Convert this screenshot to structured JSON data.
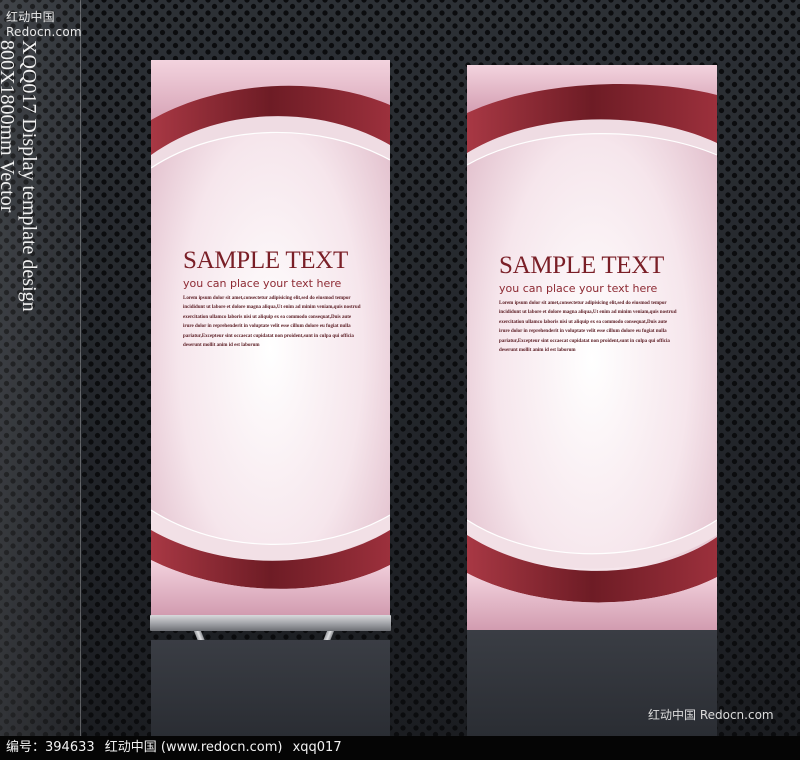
{
  "watermark_top": "红动中国 Redocn.com",
  "side_caption": {
    "line1": "XQQ017 Display template design",
    "line2": "800X1800mm Vector"
  },
  "banners": [
    {
      "title": "SAMPLE TEXT",
      "subtitle": "you can place your text here",
      "body": "Lorem ipsum dolor sit amet,consectetur adipisicing elit,sed do eiusmod tempor incididunt ut labore et dolore magna aliqua,Ut enim ad minim veniam,quis nostrud exercitation ullamco laboris nisi ut aliquip ex ea commodo consequat,Duis aute irure dolor in reprehenderit in voluptate velit esse cillum dolore eu fugiat nulla pariatur,Excepteur sint occaecat cupidatat non proident,sunt in culpa qui officia deserunt mollit anim id est laborum"
    },
    {
      "title": "SAMPLE TEXT",
      "subtitle": "you can place your text here",
      "body": "Lorem ipsum dolor sit amet,consectetur adipisicing elit,sed do eiusmod tempor incididunt ut labore et dolore magna aliqua,Ut enim ad minim veniam,quis nostrud exercitation ullamco laboris nisi ut aliquip ex ea commodo consequat,Duis aute irure dolor in reprehenderit in voluptate velit esse cillum dolore eu fugiat nulla pariatur,Excepteur sint occaecat cupidatat non proident,sunt in culpa qui officia deserunt mollit anim id est laborum"
    }
  ],
  "footer": {
    "id_label": "编号：394633",
    "site": "红动中国 (www.redocn.com)",
    "code": "xqq017"
  },
  "watermark_bottom": "红动中国 Redocn.com",
  "colors": {
    "wave_dark": "#8a2a33",
    "wave_mid": "#b5404c",
    "banner_bg": "#f7e8ee",
    "title": "#7a1f27"
  }
}
